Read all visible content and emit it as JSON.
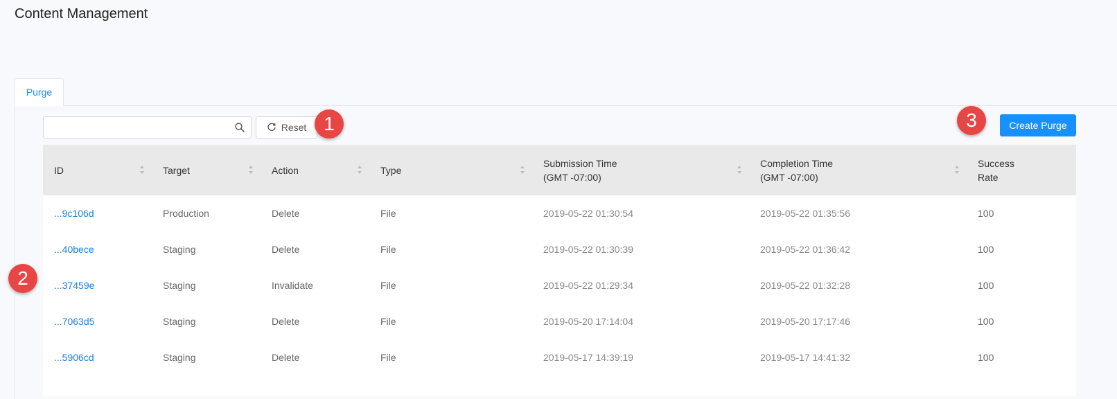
{
  "page": {
    "title": "Content Management"
  },
  "tabs": [
    {
      "label": "Purge"
    }
  ],
  "toolbar": {
    "search_placeholder": "",
    "reset_label": "Reset",
    "create_label": "Create Purge"
  },
  "annotations": [
    "1",
    "2",
    "3"
  ],
  "table": {
    "columns": [
      {
        "label": "ID",
        "sub": ""
      },
      {
        "label": "Target",
        "sub": ""
      },
      {
        "label": "Action",
        "sub": ""
      },
      {
        "label": "Type",
        "sub": ""
      },
      {
        "label": "Submission Time",
        "sub": "(GMT -07:00)"
      },
      {
        "label": "Completion Time",
        "sub": "(GMT -07:00)"
      },
      {
        "label": "Success",
        "sub": "Rate"
      }
    ],
    "rows": [
      {
        "id": "...9c106d",
        "target": "Production",
        "action": "Delete",
        "type": "File",
        "submitted": "2019-05-22 01:30:54",
        "completed": "2019-05-22 01:35:56",
        "rate": "100"
      },
      {
        "id": "...40bece",
        "target": "Staging",
        "action": "Delete",
        "type": "File",
        "submitted": "2019-05-22 01:30:39",
        "completed": "2019-05-22 01:36:42",
        "rate": "100"
      },
      {
        "id": "...37459e",
        "target": "Staging",
        "action": "Invalidate",
        "type": "File",
        "submitted": "2019-05-22 01:29:34",
        "completed": "2019-05-22 01:32:28",
        "rate": "100"
      },
      {
        "id": "...7063d5",
        "target": "Staging",
        "action": "Delete",
        "type": "File",
        "submitted": "2019-05-20 17:14:04",
        "completed": "2019-05-20 17:17:46",
        "rate": "100"
      },
      {
        "id": "...5906cd",
        "target": "Staging",
        "action": "Delete",
        "type": "File",
        "submitted": "2019-05-17 14:39:19",
        "completed": "2019-05-17 14:41:32",
        "rate": "100"
      }
    ]
  },
  "colors": {
    "accent": "#1890ff",
    "link": "#1a7fe0",
    "badge": "#e84545",
    "header_bg": "#e9e9e9"
  },
  "icons": {
    "search": "search-icon",
    "reset": "refresh-icon",
    "sort": "sort-icon"
  }
}
